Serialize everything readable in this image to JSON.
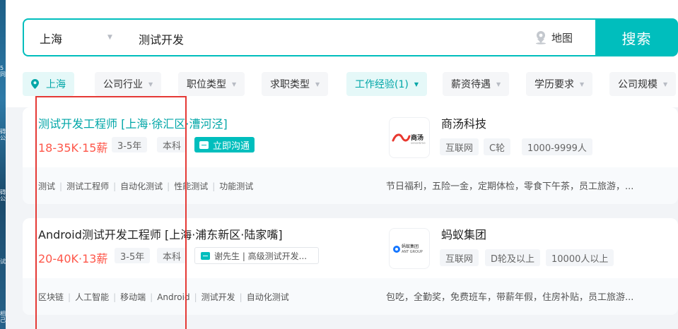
{
  "search": {
    "city": "上海",
    "keyword": "测试开发",
    "map_label": "地图",
    "button_label": "搜索"
  },
  "filters": [
    {
      "label": "上海",
      "active": true,
      "has_pin": true
    },
    {
      "label": "公司行业",
      "active": false
    },
    {
      "label": "职位类型",
      "active": false
    },
    {
      "label": "求职类型",
      "active": false
    },
    {
      "label": "工作经验(1)",
      "active": true
    },
    {
      "label": "薪资待遇",
      "active": false
    },
    {
      "label": "学历要求",
      "active": false
    },
    {
      "label": "公司规模",
      "active": false
    }
  ],
  "jobs": [
    {
      "title": "测试开发工程师  [上海·徐汇区·漕河泾]",
      "salary": "18-35K·15薪",
      "experience": "3-5年",
      "education": "本科",
      "chat_label": "立即沟通",
      "company": "商汤科技",
      "company_tags": [
        "互联网",
        "C轮",
        "1000-9999人"
      ],
      "logo_text": "商汤",
      "logo_sub": "sensetime",
      "skills": [
        "测试",
        "测试工程师",
        "自动化测试",
        "性能测试",
        "功能测试"
      ],
      "benefits": "节日福利，五险一金，定期体检，零食下午茶，员工旅游，..."
    },
    {
      "title": "Android测试开发工程师  [上海·浦东新区·陆家嘴]",
      "salary": "20-40K·13薪",
      "experience": "3-5年",
      "education": "本科",
      "recruiter": "谢先生 | 高级测试开发...",
      "company": "蚂蚁集团",
      "company_tags": [
        "互联网",
        "D轮及以上",
        "10000人以上"
      ],
      "logo_text": "蚂蚁集团",
      "logo_sub": "ANT GROUP",
      "skills": [
        "区块链",
        "人工智能",
        "移动端",
        "Android",
        "测试开发",
        "自动化测试"
      ],
      "benefits": "包吃，全勤奖，免费班车，带薪年假，住房补贴，员工旅游..."
    }
  ],
  "colors": {
    "accent": "#00bebd",
    "accent_text": "#00a6a7",
    "salary": "#fe574a",
    "annotation": "#e53935"
  }
}
